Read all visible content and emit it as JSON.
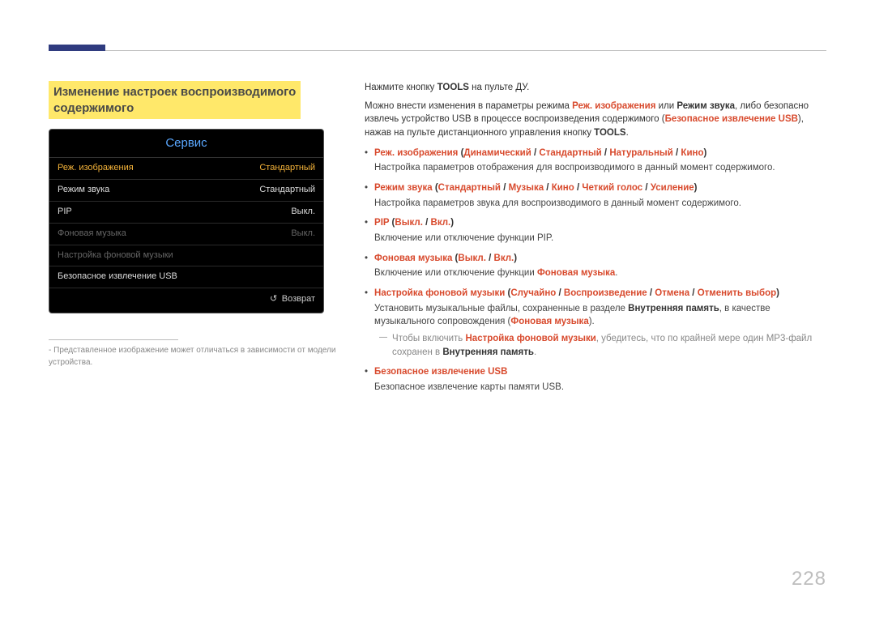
{
  "page_number": "228",
  "section_title_line1": "Изменение настроек воспроизводимого",
  "section_title_line2": "содержимого",
  "osd": {
    "title": "Сервис",
    "rows": [
      {
        "label": "Реж. изображения",
        "value": "Стандартный",
        "state": "selected"
      },
      {
        "label": "Режим звука",
        "value": "Стандартный",
        "state": ""
      },
      {
        "label": "PIP",
        "value": "Выкл.",
        "state": ""
      },
      {
        "label": "Фоновая музыка",
        "value": "Выкл.",
        "state": "disabled"
      },
      {
        "label": "Настройка фоновой музыки",
        "value": "",
        "state": "disabled"
      },
      {
        "label": "Безопасное извлечение USB",
        "value": "",
        "state": ""
      }
    ],
    "return": "Возврат"
  },
  "footnote_dash": "-",
  "footnote": "Представленное изображение может отличаться в зависимости от модели устройства.",
  "intro": {
    "p1a": "Нажмите кнопку ",
    "p1b": "TOOLS",
    "p1c": " на пульте ДУ.",
    "p2a": "Можно внести изменения в параметры режима ",
    "p2b": "Реж. изображения",
    "p2c": " или ",
    "p2d": "Режим звука",
    "p2e": ", либо безопасно извлечь устройство USB в процессе воспроизведения содержимого (",
    "p2f": "Безопасное извлечение USB",
    "p2g": "), нажав на пульте дистанционного управления кнопку ",
    "p2h": "TOOLS",
    "p2i": "."
  },
  "items": [
    {
      "title_parts": [
        "Реж. изображения",
        " (",
        "Динамический",
        " / ",
        "Стандартный",
        " / ",
        "Натуральный",
        " / ",
        "Кино",
        ")"
      ],
      "desc": "Настройка параметров отображения для воспроизводимого в данный момент содержимого."
    },
    {
      "title_parts": [
        "Режим звука",
        " (",
        "Стандартный",
        " / ",
        "Музыка",
        "  / ",
        "Кино",
        " / ",
        "Четкий голос",
        " / ",
        "Усиление",
        ")"
      ],
      "desc": "Настройка параметров звука для воспроизводимого в данный момент содержимого."
    },
    {
      "title_parts": [
        "PIP",
        " (",
        "Выкл.",
        " / ",
        "Вкл.",
        ")"
      ],
      "desc": "Включение или отключение функции PIP."
    },
    {
      "title_parts": [
        "Фоновая музыка",
        " (",
        "Выкл.",
        " / ",
        "Вкл.",
        ")"
      ],
      "desc_pre": "Включение или отключение функции ",
      "desc_red": "Фоновая музыка",
      "desc_post": "."
    },
    {
      "title_parts": [
        "Настройка фоновой музыки",
        " (",
        "Случайно",
        " / ",
        "Воспроизведение",
        " / ",
        "Отмена",
        " / ",
        "Отменить выбор",
        ")"
      ],
      "desc_pre": "Установить музыкальные файлы, сохраненные в разделе ",
      "desc_bold1": "Внутренняя память",
      "desc_mid": ", в качестве музыкального сопровождения (",
      "desc_red": "Фоновая музыка",
      "desc_post": ").",
      "note_pre": "Чтобы включить ",
      "note_red": "Настройка фоновой музыки",
      "note_mid": ", убедитесь, что по крайней мере один MP3-файл сохранен в ",
      "note_bold": "Внутренняя память",
      "note_post": "."
    },
    {
      "title_parts": [
        "Безопасное извлечение USB"
      ],
      "desc": "Безопасное извлечение карты памяти USB."
    }
  ]
}
